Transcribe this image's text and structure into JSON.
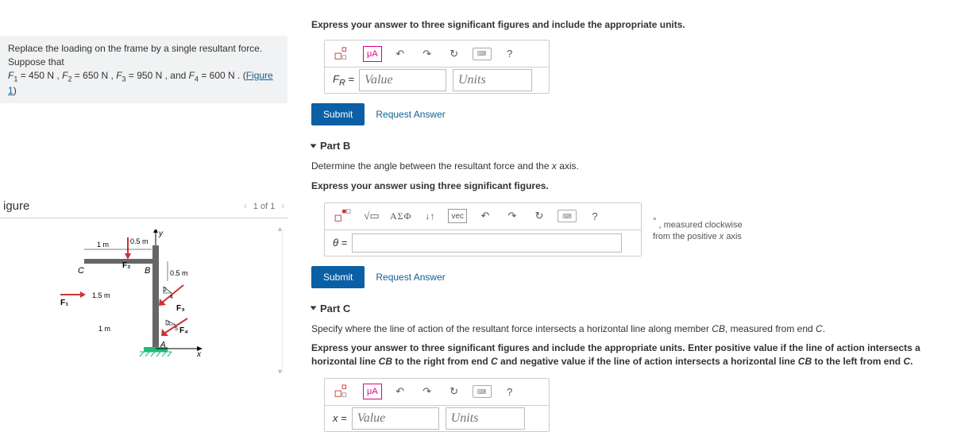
{
  "problem": {
    "line1_prefix": "Replace the loading on the frame by a single resultant force. Suppose that",
    "line2_pre": "F",
    "f1_val": "450",
    "f2_val": "650",
    "f3_val": "950",
    "f4_val": "600",
    "figure_link": "Figure 1"
  },
  "figure": {
    "title": "igure",
    "counter": "1 of 1"
  },
  "partA": {
    "prompt_bold": "Express your answer to three significant figures and include the appropriate units.",
    "var_label": "F_R =",
    "value_placeholder": "Value",
    "units_placeholder": "Units",
    "submit_label": "Submit",
    "request_label": "Request Answer"
  },
  "partB": {
    "header": "Part B",
    "line1": "Determine the angle between the resultant force and the x axis.",
    "prompt_bold": "Express your answer using three significant figures.",
    "var_label": "θ =",
    "hint_line1": "° , measured clockwise",
    "hint_line2": "from the positive x axis",
    "submit_label": "Submit",
    "request_label": "Request Answer"
  },
  "partC": {
    "header": "Part C",
    "line1_a": "Specify where the line of action of the resultant force intersects a horizontal line along member ",
    "line1_b": "CB",
    "line1_c": ", measured from end ",
    "line1_d": "C",
    "line1_e": ".",
    "prompt_bold_a": "Express your answer to three significant figures and include the appropriate units. Enter positive value if the line of action intersects a horizontal line ",
    "prompt_bold_b": "CB",
    "prompt_bold_c": " to the right from end ",
    "prompt_bold_d": "C",
    "prompt_bold_e": " and negative value if the line of action intersects a horizontal line ",
    "prompt_bold_f": "CB",
    "prompt_bold_g": " to the left from end ",
    "prompt_bold_h": "C",
    "prompt_bold_i": ".",
    "var_label": "x =",
    "value_placeholder": "Value",
    "units_placeholder": "Units"
  },
  "diagram": {
    "labels": {
      "y": "y",
      "x": "x",
      "C": "C",
      "B": "B",
      "A": "A",
      "F1": "F₁",
      "F2": "F₂",
      "F3": "F₃",
      "F4": "F₄",
      "d_1m": "1 m",
      "d_0p5m_top": "0.5 m",
      "d_0p5m_side": "0.5 m",
      "d_1p5m": "1.5 m",
      "d_1m_low": "1 m",
      "angle_2": "2",
      "angle_4": "4",
      "angle_3": "3",
      "angle_5": "5"
    }
  },
  "greek": "ΑΣΦ"
}
